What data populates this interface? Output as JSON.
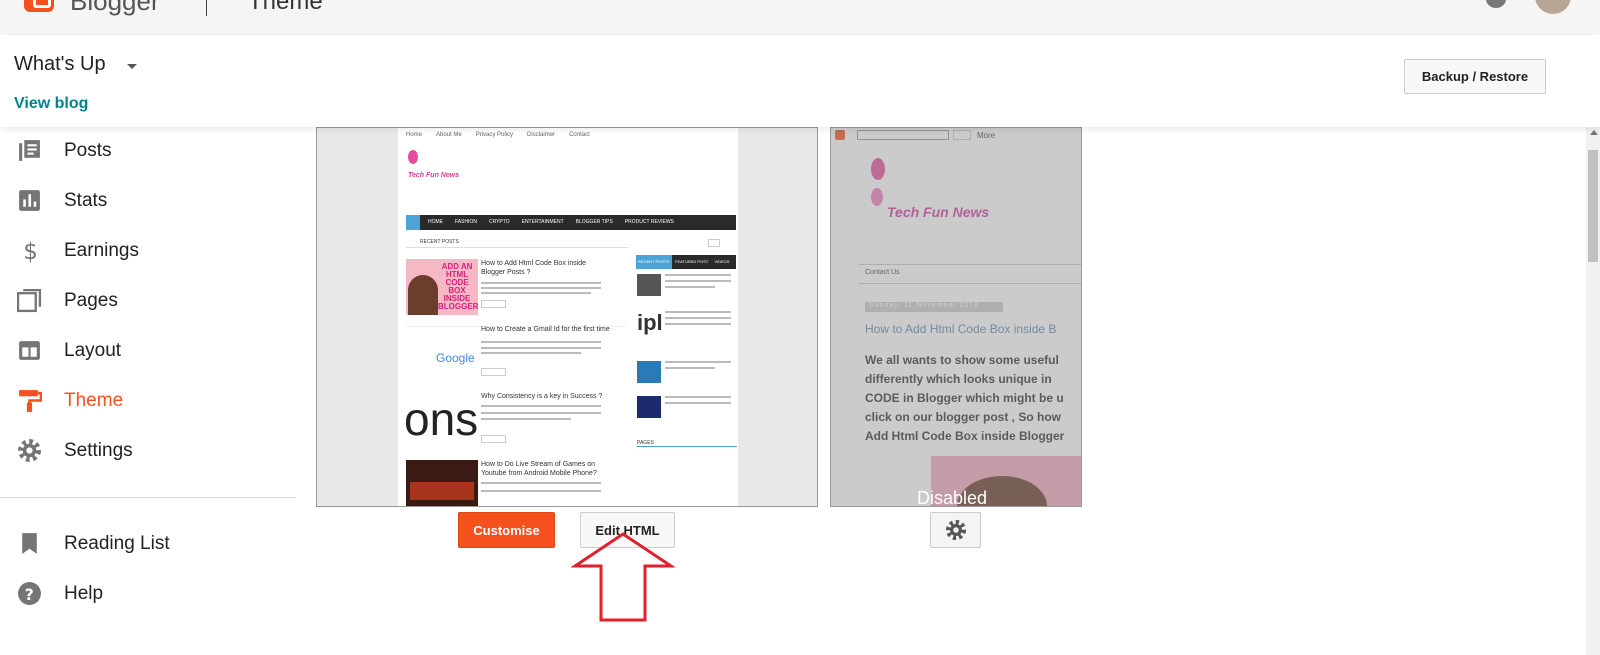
{
  "topbar": {
    "brand": "Blogger",
    "title": "Theme"
  },
  "header": {
    "blog_name": "What's Up",
    "view_blog": "View blog",
    "backup_label": "Backup / Restore"
  },
  "sidebar": {
    "items": [
      {
        "label": "Posts",
        "icon": "posts-icon"
      },
      {
        "label": "Stats",
        "icon": "stats-icon"
      },
      {
        "label": "Earnings",
        "icon": "dollar-icon"
      },
      {
        "label": "Pages",
        "icon": "pages-icon"
      },
      {
        "label": "Layout",
        "icon": "layout-icon"
      },
      {
        "label": "Theme",
        "icon": "paint-roller-icon",
        "active": true
      },
      {
        "label": "Settings",
        "icon": "gear-icon"
      }
    ],
    "bottom_items": [
      {
        "label": "Reading List",
        "icon": "bookmark-icon"
      },
      {
        "label": "Help",
        "icon": "help-icon"
      }
    ]
  },
  "live_preview": {
    "top_nav": [
      "Home",
      "About Me",
      "Privacy Policy",
      "Disclaimer",
      "Contact"
    ],
    "logo_text": "Tech Fun News",
    "menu": [
      "HOME",
      "FASHION",
      "CRYPTO",
      "ENTERTAINMENT",
      "BLOGGER TIPS",
      "PRODUCT REVIEWS"
    ],
    "section_label": "RECENT POSTS",
    "thumb_text": "ADD AN HTML CODE BOX INSIDE BLOGGER",
    "google_text": "Google",
    "ons_text": "ons",
    "posts": [
      "How to Add Html Code Box inside Blogger Posts ?",
      "How to Create a Gmail Id for the first time",
      "Why Consistency is a key in Success ?",
      "How to Do Live Stream of Games on Youtube from Android Mobile Phone?"
    ],
    "read_more": "Read More",
    "tabs": [
      "RECENT POSTS",
      "FEATURED POST",
      "VIDEOS"
    ],
    "side_logo": "ipl",
    "pages_label": "PAGES"
  },
  "mobile_preview": {
    "more_label": "More",
    "logo_text": "Tech Fun News",
    "contact_tab": "Contact Us",
    "date": "Sunday, 11 November 2018",
    "post_title": "How to Add Html Code Box inside B",
    "body_lines": [
      "We all wants to show some useful",
      "differently which looks unique in",
      "CODE in Blogger which might be u",
      "click on our blogger post , So how",
      "Add Html Code Box inside Blogger"
    ],
    "disabled_label": "Disabled"
  },
  "actions": {
    "customise": "Customise",
    "edit_html": "Edit HTML"
  },
  "colors": {
    "accent": "#f4511e",
    "link": "#00838f",
    "arrow": "#e0202a"
  }
}
